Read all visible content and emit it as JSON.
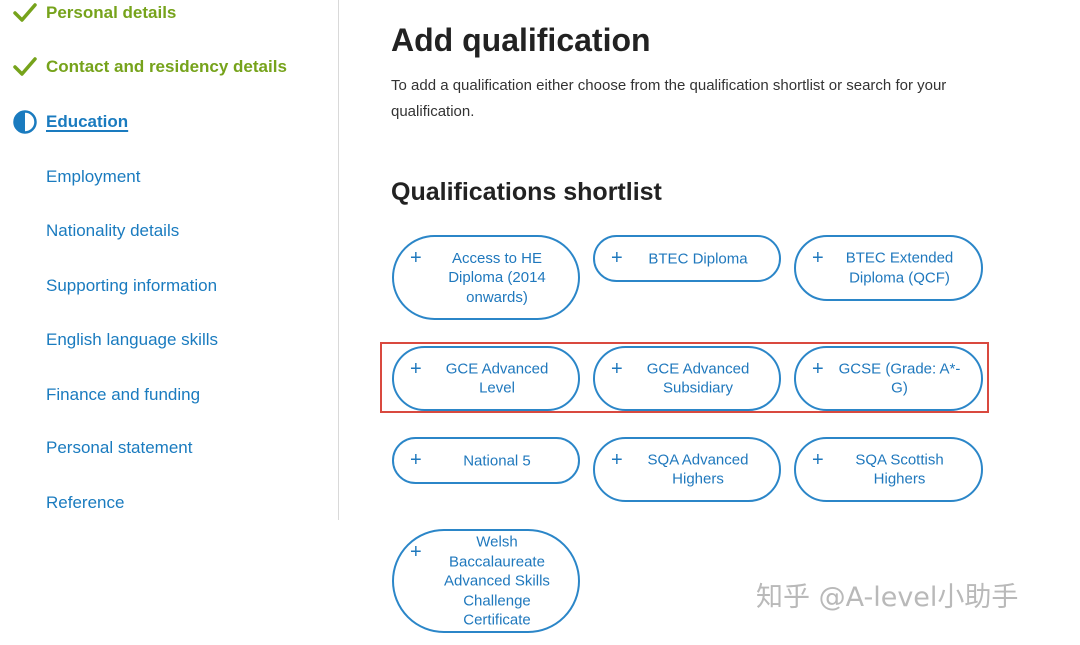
{
  "sidebar": {
    "items": [
      {
        "label": "Personal details",
        "status": "complete",
        "icon": "check-icon"
      },
      {
        "label": "Contact and residency details",
        "status": "complete",
        "icon": "check-icon"
      },
      {
        "label": "Education",
        "status": "current",
        "icon": "half-circle-icon"
      },
      {
        "label": "Employment",
        "status": "pending"
      },
      {
        "label": "Nationality details",
        "status": "pending"
      },
      {
        "label": "Supporting information",
        "status": "pending"
      },
      {
        "label": "English language skills",
        "status": "pending"
      },
      {
        "label": "Finance and funding",
        "status": "pending"
      },
      {
        "label": "Personal statement",
        "status": "pending"
      },
      {
        "label": "Reference",
        "status": "pending"
      }
    ]
  },
  "main": {
    "title": "Add qualification",
    "intro": "To add a qualification either choose from the qualification shortlist or search for your qualification.",
    "shortlist_title": "Qualifications shortlist",
    "plus_glyph": "+",
    "qualifications": [
      {
        "label": "Access to HE Diploma (2014 onwards)"
      },
      {
        "label": "BTEC Diploma"
      },
      {
        "label": "BTEC Extended Diploma (QCF)"
      },
      {
        "label": "GCE Advanced Level"
      },
      {
        "label": "GCE Advanced Subsidiary"
      },
      {
        "label": "GCSE (Grade: A*-G)"
      },
      {
        "label": "National 5"
      },
      {
        "label": "SQA Advanced Highers"
      },
      {
        "label": "SQA Scottish Highers"
      },
      {
        "label": "Welsh Baccalaureate Advanced Skills Challenge Certificate"
      }
    ]
  },
  "watermark": "知乎 @A-level小助手",
  "colors": {
    "complete": "#76a31b",
    "link": "#1a7bbf",
    "pill_border": "#2b86c8",
    "highlight": "#d9493f"
  }
}
